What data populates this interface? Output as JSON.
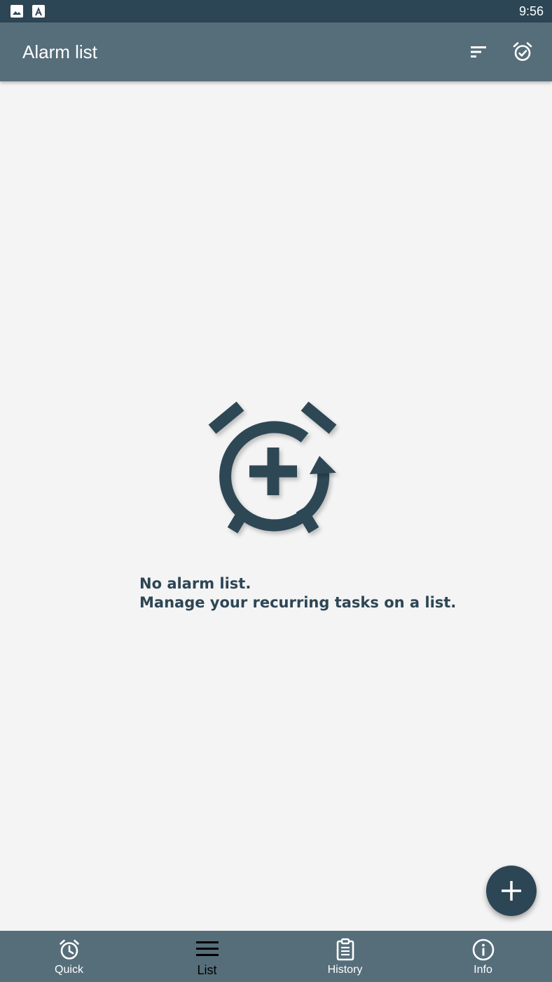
{
  "status_bar": {
    "time": "9:56",
    "notification_icons": [
      "image-icon",
      "app-store-icon"
    ]
  },
  "toolbar": {
    "title": "Alarm list",
    "actions": [
      {
        "icon": "sort-icon"
      },
      {
        "icon": "alarm-check-icon"
      }
    ]
  },
  "empty_state": {
    "icon": "alarm-add-icon",
    "line1": "No alarm list.",
    "line2": "Manage your recurring tasks on a list."
  },
  "fab": {
    "icon": "plus-icon"
  },
  "bottom_nav": {
    "items": [
      {
        "label": "Quick",
        "icon": "alarm-clock-icon",
        "active": false
      },
      {
        "label": "List",
        "icon": "list-icon",
        "active": true
      },
      {
        "label": "History",
        "icon": "clipboard-icon",
        "active": false
      },
      {
        "label": "Info",
        "icon": "info-icon",
        "active": false
      }
    ]
  },
  "colors": {
    "status_bar": "#2d4655",
    "toolbar": "#566e7a",
    "background": "#f4f4f4",
    "accent": "#2d4655",
    "active_nav": "#000000"
  }
}
